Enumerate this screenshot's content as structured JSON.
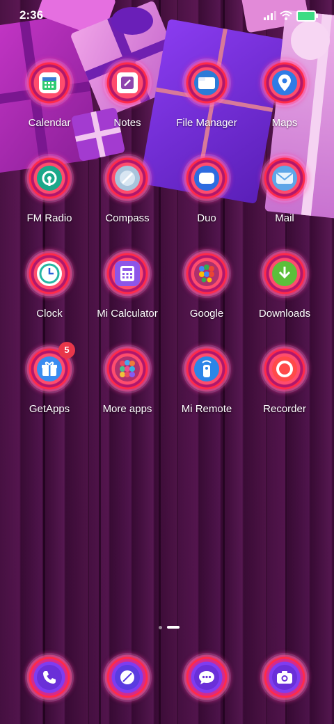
{
  "status_bar": {
    "time": "2:36"
  },
  "apps": [
    {
      "label": "Calendar",
      "icon": "calendar-icon"
    },
    {
      "label": "Notes",
      "icon": "notes-icon"
    },
    {
      "label": "File Manager",
      "icon": "folder-icon"
    },
    {
      "label": "Maps",
      "icon": "map-pin-icon"
    },
    {
      "label": "FM Radio",
      "icon": "radio-icon"
    },
    {
      "label": "Compass",
      "icon": "compass-icon"
    },
    {
      "label": "Duo",
      "icon": "video-icon"
    },
    {
      "label": "Mail",
      "icon": "mail-icon"
    },
    {
      "label": "Clock",
      "icon": "clock-icon"
    },
    {
      "label": "Mi Calculator",
      "icon": "calculator-icon"
    },
    {
      "label": "Google",
      "icon": "google-folder-icon"
    },
    {
      "label": "Downloads",
      "icon": "download-icon"
    },
    {
      "label": "GetApps",
      "icon": "gift-icon",
      "badge": "5"
    },
    {
      "label": "More apps",
      "icon": "apps-folder-icon"
    },
    {
      "label": "Mi Remote",
      "icon": "remote-icon"
    },
    {
      "label": "Recorder",
      "icon": "record-icon"
    }
  ],
  "dock": [
    {
      "icon": "phone-icon"
    },
    {
      "icon": "browser-icon"
    },
    {
      "icon": "messages-icon"
    },
    {
      "icon": "camera-icon"
    }
  ],
  "pager": {
    "pages": 2,
    "current": 2
  },
  "colors": {
    "badge": "#e8364a",
    "battery": "#3ddc84"
  }
}
